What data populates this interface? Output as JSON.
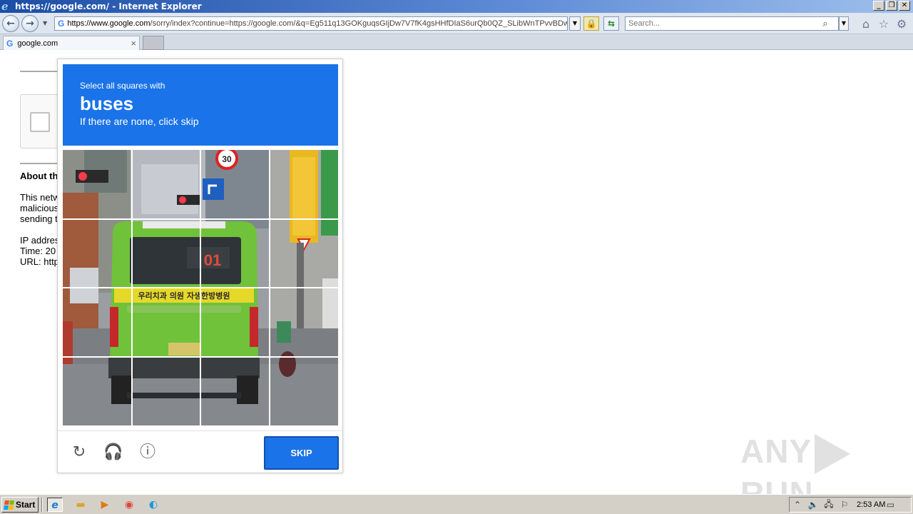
{
  "window": {
    "title": "https://google.com/ - Internet Explorer",
    "controls": [
      "_",
      "❐",
      "✕"
    ]
  },
  "navbar": {
    "url_domain": "https://www.google.com",
    "url_rest": "/sorry/index?continue=https://google.com/&q=Eg511q13GOKguqsGIjDw7V7fK4gsHHfDIaS6urQb0QZ_SLibWnTPvvBDwt",
    "search_placeholder": "Search..."
  },
  "tab": {
    "label": "google.com",
    "close_glyph": "×"
  },
  "background_page": {
    "about_heading": "About th",
    "lines": [
      "This netw",
      "malicious",
      "sending t",
      "",
      "IP addres",
      "Time: 20",
      "URL: http"
    ]
  },
  "captcha": {
    "instruction": "Select all squares with",
    "target": "buses",
    "hint": "If there are none, click skip",
    "skip_label": "SKIP",
    "icons": [
      "reload-icon",
      "headphones-icon",
      "info-icon"
    ],
    "accent_color": "#1a73e8",
    "grid_size": 4,
    "tiles": [
      "",
      "",
      "",
      "",
      "",
      "",
      "",
      "",
      "",
      "",
      "",
      "",
      "",
      "",
      "",
      ""
    ],
    "scene_text": {
      "speed_sign": "30",
      "bus_number": "01",
      "bus_banner": "우리치과 의원 자생한방병원"
    }
  },
  "watermark": {
    "left": "ANY",
    "right": "RUN"
  },
  "taskbar": {
    "start_label": "Start",
    "clock": "2:53 AM"
  }
}
